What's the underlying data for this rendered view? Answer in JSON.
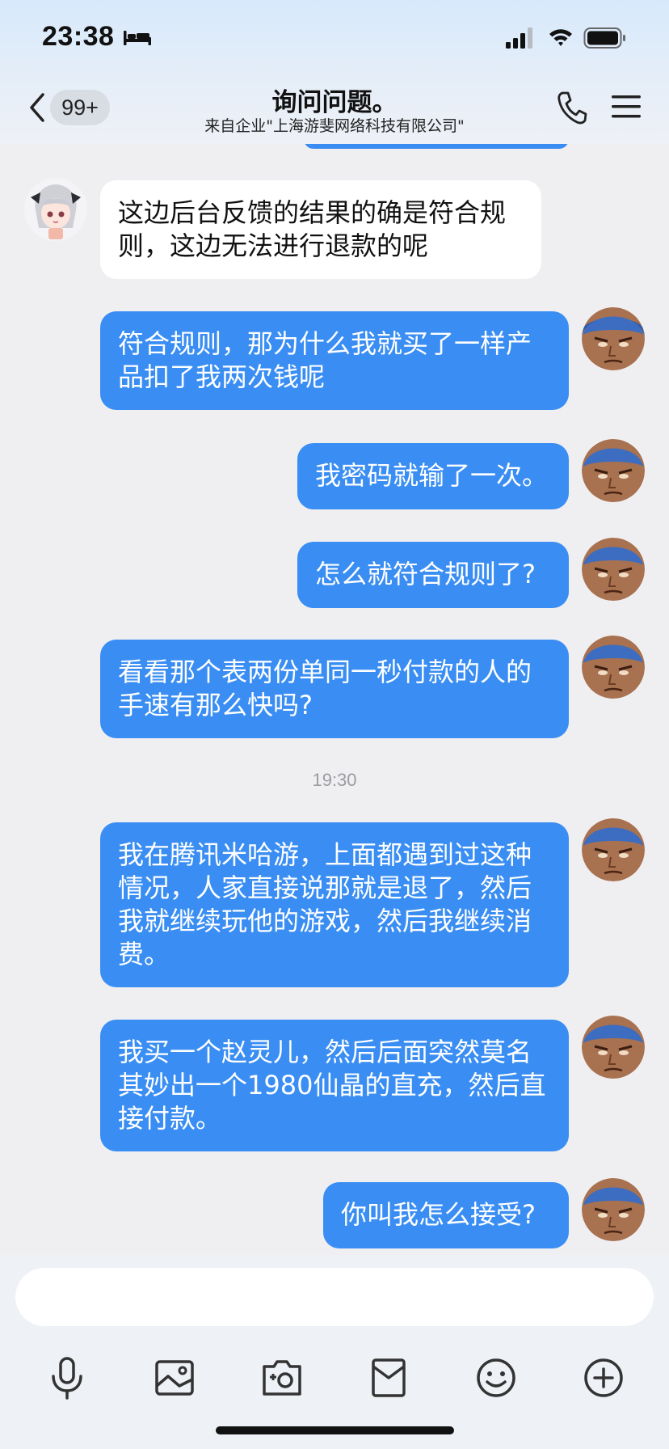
{
  "status_bar": {
    "time": "23:38"
  },
  "header": {
    "unread_count": "99+",
    "title": "询问问题。",
    "subtitle": "来自企业\"上海游斐网络科技有限公司\""
  },
  "messages": [
    {
      "side": "in",
      "text": "这边后台反馈的结果的确是符合规则，这边无法进行退款的呢"
    },
    {
      "side": "out",
      "text": "符合规则，那为什么我就买了一样产品扣了我两次钱呢"
    },
    {
      "side": "out",
      "text": "我密码就输了一次。"
    },
    {
      "side": "out",
      "text": "怎么就符合规则了?"
    },
    {
      "side": "out",
      "text": "看看那个表两份单同一秒付款的人的手速有那么快吗?"
    },
    {
      "side": "out",
      "text": "我在腾讯米哈游，上面都遇到过这种情况，人家直接说那就是退了，然后我就继续玩他的游戏，然后我继续消费。"
    },
    {
      "side": "out",
      "text": "我买一个赵灵儿，然后后面突然莫名其妙出一个1980仙晶的直充，然后直接付款。"
    },
    {
      "side": "out",
      "text": "你叫我怎么接受?"
    }
  ],
  "timestamp": "19:30",
  "composer": {
    "input_value": "",
    "tools": [
      "microphone-icon",
      "image-icon",
      "camera-icon",
      "red-packet-icon",
      "emoji-icon",
      "plus-icon"
    ]
  },
  "colors": {
    "accent": "#3a8ef3",
    "incoming_bubble": "#ffffff",
    "background": "#efeff2"
  }
}
